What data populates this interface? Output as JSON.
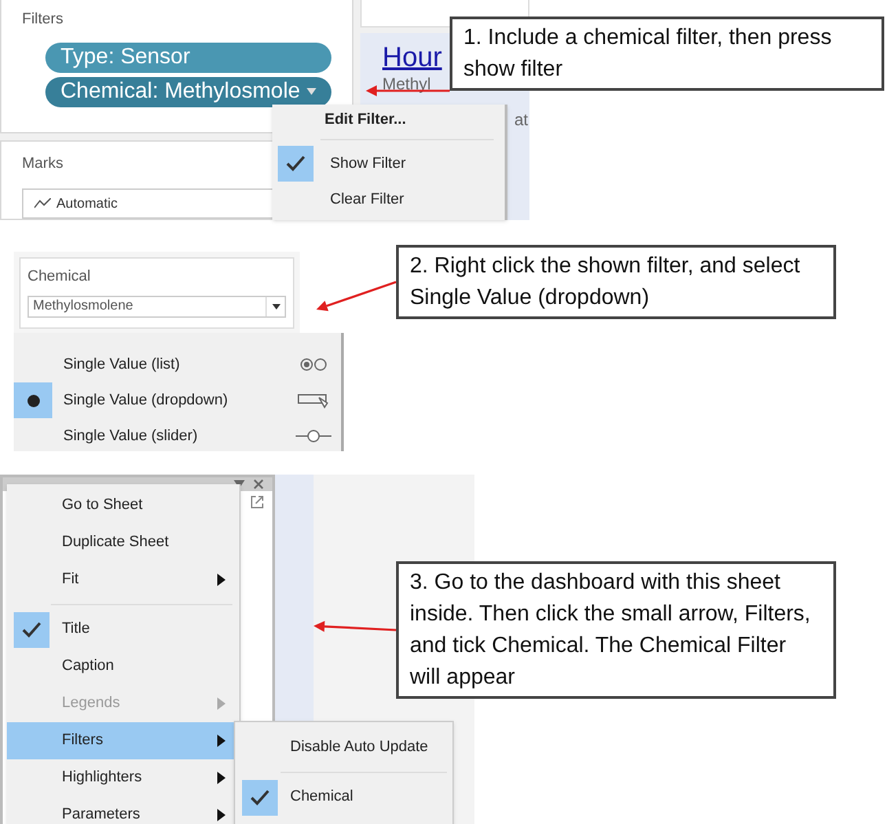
{
  "step1": {
    "filters_title": "Filters",
    "pills": [
      {
        "label": "Type: Sensor",
        "dropdown": false
      },
      {
        "label": "Chemical: Methylosmole",
        "dropdown": true
      }
    ],
    "marks_title": "Marks",
    "mark_type": "Automatic",
    "sheet_title": "Hour",
    "sheet_subtitle": "Methyl",
    "sheet_text": "at",
    "menu": [
      {
        "label": "Edit Filter...",
        "kind": "header"
      },
      {
        "label": "Show Filter",
        "kind": "check",
        "checked": true
      },
      {
        "label": "Clear Filter",
        "kind": "check",
        "checked": false
      }
    ],
    "callout": "1. Include a chemical filter, then press show filter"
  },
  "step2": {
    "filter_title": "Chemical",
    "filter_value": "Methylosmolene",
    "menu": [
      {
        "label": "Single Value (list)",
        "kind": "list",
        "selected": false
      },
      {
        "label": "Single Value (dropdown)",
        "kind": "dropdown",
        "selected": true
      },
      {
        "label": "Single Value (slider)",
        "kind": "slider",
        "selected": false
      }
    ],
    "callout": "2. Right click the shown filter, and select Single Value (dropdown)"
  },
  "step3": {
    "menu": [
      {
        "label": "Go to Sheet",
        "kind": "item",
        "submenu": false
      },
      {
        "label": "Duplicate Sheet",
        "kind": "item",
        "submenu": false
      },
      {
        "label": "Fit",
        "kind": "item",
        "submenu": true
      },
      {
        "label": "Title",
        "kind": "check",
        "checked": true
      },
      {
        "label": "Caption",
        "kind": "check",
        "checked": false
      },
      {
        "label": "Legends",
        "kind": "item",
        "submenu": true,
        "disabled": true
      },
      {
        "label": "Filters",
        "kind": "item",
        "submenu": true,
        "selected": true
      },
      {
        "label": "Highlighters",
        "kind": "item",
        "submenu": true
      },
      {
        "label": "Parameters",
        "kind": "item",
        "submenu": true
      }
    ],
    "submenu": [
      {
        "label": "Disable Auto Update",
        "kind": "item"
      },
      {
        "label": "Chemical",
        "kind": "check",
        "checked": true
      }
    ],
    "callout": "3. Go to the dashboard with this sheet inside. Then click the small arrow, Filters, and tick Chemical. The Chemical Filter will appear"
  }
}
